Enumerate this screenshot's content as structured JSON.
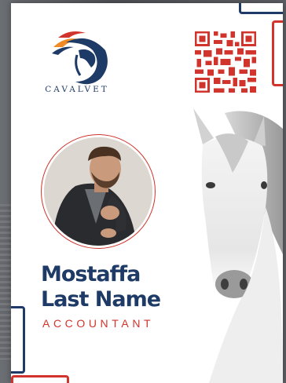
{
  "brand": {
    "name": "CAVALVET",
    "primary_color": "#1e3a66",
    "accent_color": "#d0342c",
    "secondary_accent": "#f08a24"
  },
  "badge": {
    "first_name": "Mostaffa",
    "last_name": "Last Name",
    "role": "ACCOUNTANT"
  },
  "icons": {
    "logo": "horse-logo-icon",
    "qr": "qr-code-icon",
    "portrait": "person-photo",
    "horse": "white-horse-image"
  }
}
